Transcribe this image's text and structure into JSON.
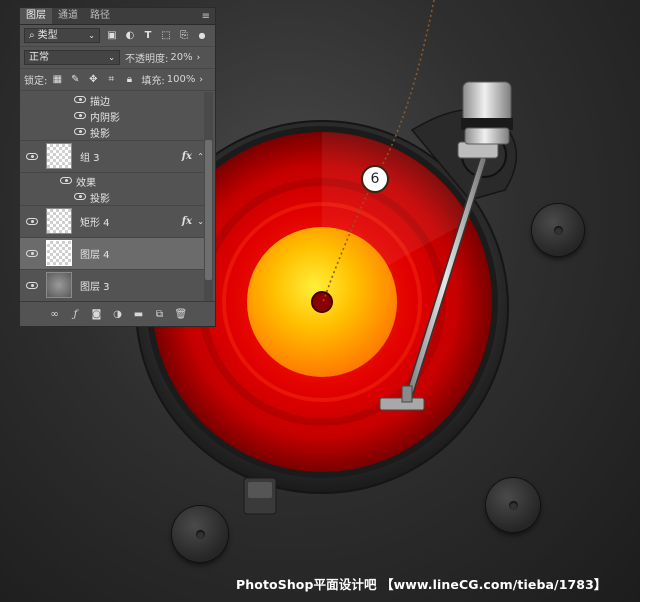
{
  "panel": {
    "tabs": [
      "图层",
      "通道",
      "路径"
    ],
    "filter_kind": "类型",
    "blend_mode": "正常",
    "opacity_label": "不透明度:",
    "opacity_value": "20%",
    "lock_label": "锁定:",
    "fill_label": "填充:",
    "fill_value": "100%",
    "effects": {
      "stroke": "描边",
      "inner_shadow": "内阴影",
      "drop_shadow": "投影",
      "effects_header": "效果"
    },
    "layers": {
      "group3": "组 3",
      "rect4": "矩形 4",
      "layer4": "图层 4",
      "layer3": "图层 3"
    },
    "fx_label": "fx"
  },
  "canvas": {
    "step_number": "6",
    "watermark": "PhotoShop平面设计吧 【www.lineCG.com/tieba/1783】",
    "colors": {
      "background": "#2f2f2f",
      "record_red": "#e00000",
      "label_orange": "#ff9a00",
      "label_yellow": "#ffe000"
    }
  }
}
